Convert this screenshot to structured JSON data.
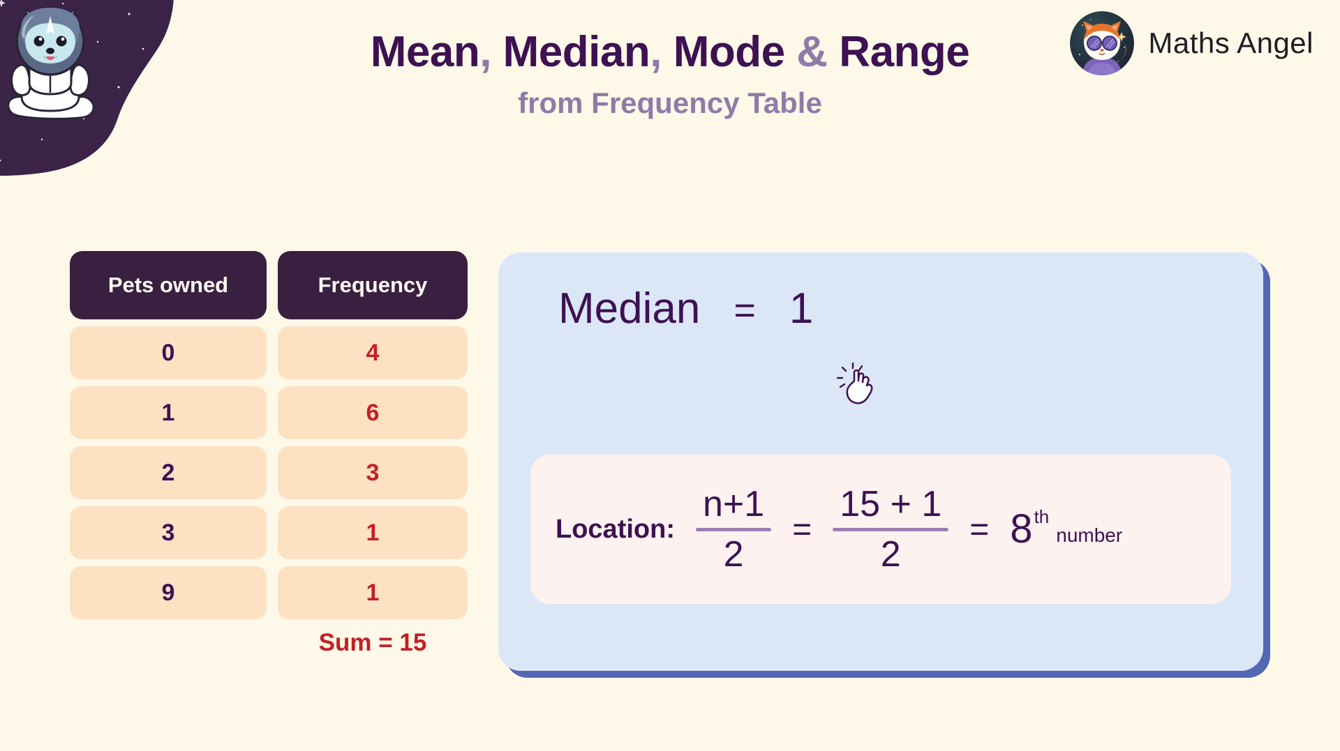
{
  "header": {
    "title_parts": [
      {
        "text": "Mean",
        "muted": false
      },
      {
        "text": ", ",
        "muted": true
      },
      {
        "text": "Median",
        "muted": false
      },
      {
        "text": ", ",
        "muted": true
      },
      {
        "text": "Mode ",
        "muted": false
      },
      {
        "text": "& ",
        "muted": true
      },
      {
        "text": "Range",
        "muted": false
      }
    ],
    "title_plain": "Mean, Median, Mode & Range",
    "subtitle": "from Frequency Table",
    "brand_name": "Maths Angel",
    "logo_icon": "fox-astronaut-logo-icon",
    "mascot_icon": "husky-astronaut-mascot-icon"
  },
  "table": {
    "columns": [
      "Pets owned",
      "Frequency"
    ],
    "rows": [
      {
        "category": "0",
        "frequency": "4"
      },
      {
        "category": "1",
        "frequency": "6"
      },
      {
        "category": "2",
        "frequency": "3"
      },
      {
        "category": "3",
        "frequency": "1"
      },
      {
        "category": "9",
        "frequency": "1"
      }
    ],
    "sum_label": "Sum = 15"
  },
  "panel": {
    "median_label": "Median",
    "equals": "=",
    "median_value": "1",
    "cursor_icon": "tap-hand-cursor-icon",
    "formula": {
      "location_label": "Location:",
      "fraction_1": {
        "numerator": "n+1",
        "denominator": "2"
      },
      "equals_1": "=",
      "fraction_2": {
        "numerator": "15 + 1",
        "denominator": "2"
      },
      "equals_2": "=",
      "result_number": "8",
      "result_suffix": "th",
      "result_word": "number"
    }
  },
  "chart_data": {
    "type": "table",
    "title": "Mean, Median, Mode & Range from Frequency Table",
    "categories": [
      "0",
      "1",
      "2",
      "3",
      "9"
    ],
    "values": [
      4,
      6,
      3,
      1,
      1
    ],
    "xlabel": "Pets owned",
    "ylabel": "Frequency",
    "total_frequency": 15,
    "median": 1,
    "median_location": 8,
    "annotations": [
      "Sum = 15",
      "Location: (n+1)/2 = (15+1)/2 = 8th number",
      "Median = 1"
    ]
  },
  "colors": {
    "background": "#fdf8e7",
    "header_dark": "#3a2040",
    "title_purple": "#3d1152",
    "muted_purple": "#8f7aa8",
    "cell_peach": "#fce1c3",
    "accent_red": "#c31f26",
    "panel_blue": "#dbe7f7",
    "panel_shadow_blue": "#5367b4",
    "formula_card": "#fdf2f0"
  }
}
